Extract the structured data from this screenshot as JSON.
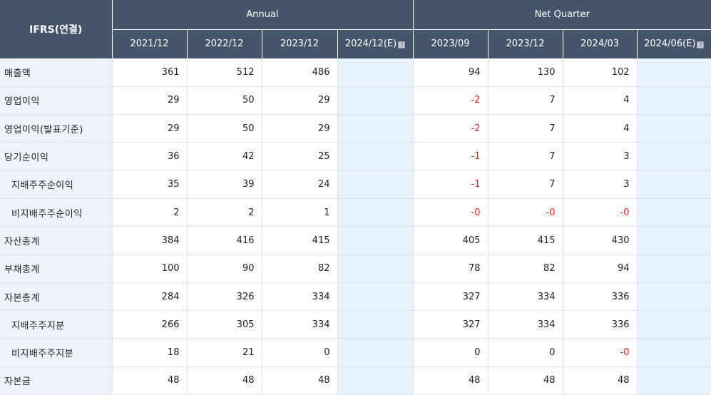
{
  "header": {
    "corner": "IFRS(연결)",
    "annual_label": "Annual",
    "quarter_label": "Net Quarter",
    "annual_periods": [
      "2021/12",
      "2022/12",
      "2023/12",
      "2024/12(E)"
    ],
    "quarter_periods": [
      "2023/09",
      "2023/12",
      "2024/03",
      "2024/06(E)"
    ],
    "estimate_icon": "info-icon"
  },
  "rows": [
    {
      "label": "매출액",
      "indent": false,
      "annual": [
        "361",
        "512",
        "486",
        ""
      ],
      "quarter": [
        "94",
        "130",
        "102",
        ""
      ]
    },
    {
      "label": "영업이익",
      "indent": false,
      "annual": [
        "29",
        "50",
        "29",
        ""
      ],
      "quarter": [
        "-2",
        "7",
        "4",
        ""
      ]
    },
    {
      "label": "영업이익(발표기준)",
      "indent": false,
      "annual": [
        "29",
        "50",
        "29",
        ""
      ],
      "quarter": [
        "-2",
        "7",
        "4",
        ""
      ]
    },
    {
      "label": "당기순이익",
      "indent": false,
      "annual": [
        "36",
        "42",
        "25",
        ""
      ],
      "quarter": [
        "-1",
        "7",
        "3",
        ""
      ]
    },
    {
      "label": "지배주주순이익",
      "indent": true,
      "annual": [
        "35",
        "39",
        "24",
        ""
      ],
      "quarter": [
        "-1",
        "7",
        "3",
        ""
      ]
    },
    {
      "label": "비지배주주순이익",
      "indent": true,
      "annual": [
        "2",
        "2",
        "1",
        ""
      ],
      "quarter": [
        "-0",
        "-0",
        "-0",
        ""
      ]
    },
    {
      "label": "자산총계",
      "indent": false,
      "annual": [
        "384",
        "416",
        "415",
        ""
      ],
      "quarter": [
        "405",
        "415",
        "430",
        ""
      ]
    },
    {
      "label": "부채총계",
      "indent": false,
      "annual": [
        "100",
        "90",
        "82",
        ""
      ],
      "quarter": [
        "78",
        "82",
        "94",
        ""
      ]
    },
    {
      "label": "자본총계",
      "indent": false,
      "annual": [
        "284",
        "326",
        "334",
        ""
      ],
      "quarter": [
        "327",
        "334",
        "336",
        ""
      ]
    },
    {
      "label": "지배주주지분",
      "indent": true,
      "annual": [
        "266",
        "305",
        "334",
        ""
      ],
      "quarter": [
        "327",
        "334",
        "336",
        ""
      ]
    },
    {
      "label": "비지배주주지분",
      "indent": true,
      "annual": [
        "18",
        "21",
        "0",
        ""
      ],
      "quarter": [
        "0",
        "0",
        "-0",
        ""
      ]
    },
    {
      "label": "자본금",
      "indent": false,
      "annual": [
        "48",
        "48",
        "48",
        ""
      ],
      "quarter": [
        "48",
        "48",
        "48",
        ""
      ]
    }
  ],
  "colors": {
    "header_bg": "#44546a",
    "label_bg": "#eef3fa",
    "estimate_bg": "#e9f3fb",
    "negative": "#e02020"
  }
}
